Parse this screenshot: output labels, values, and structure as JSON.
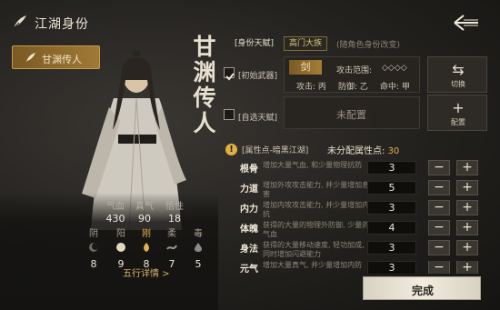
{
  "header": {
    "title": "江湖身份",
    "back_icon": "back-arrow-icon"
  },
  "sidebar": {
    "tab_label": "甘渊传人"
  },
  "character": {
    "display_name_chars": [
      "甘",
      "渊",
      "传",
      "人"
    ]
  },
  "stats": [
    {
      "label": "气血",
      "value": "430"
    },
    {
      "label": "真气",
      "value": "90"
    },
    {
      "label": "悟性",
      "value": "18"
    }
  ],
  "elements": [
    {
      "label": "阴",
      "value": "8",
      "icon": "yin-icon",
      "color": "#6d6a64"
    },
    {
      "label": "阳",
      "value": "9",
      "icon": "yang-icon",
      "color": "#e2d9c5"
    },
    {
      "label": "刚",
      "value": "8",
      "icon": "gang-icon",
      "color": "#e2b04c"
    },
    {
      "label": "柔",
      "value": "7",
      "icon": "rou-icon",
      "color": "#9c968b"
    },
    {
      "label": "毒",
      "value": "5",
      "icon": "poison-icon",
      "color": "#8a8a8a"
    }
  ],
  "details_button": "五行详情 >",
  "identity": {
    "label": "[身份天赋]",
    "sect": "高门大族",
    "note": "(随角色身份改变)"
  },
  "weapon": {
    "label": "[初始武器]",
    "type": "剑",
    "range_label": "攻击范围:",
    "range_value": "◇◇◇◇",
    "attack": "攻击: 丙",
    "defense": "防御: 乙",
    "accuracy": "命中: 甲",
    "switch_label": "切换"
  },
  "talent": {
    "label": "[自选天赋]",
    "status": "未配置",
    "config_label": "配置"
  },
  "attributes_header": {
    "title": "[属性点-暗黑江湖]",
    "unallocated_label": "未分配属性点:",
    "unallocated_value": "30"
  },
  "attributes": [
    {
      "name": "根骨",
      "desc": "增加大量气血, 和少量物理抗防",
      "value": "3"
    },
    {
      "name": "力道",
      "desc": "增加外攻攻击能力, 并少量增加息害",
      "value": "5"
    },
    {
      "name": "内力",
      "desc": "增加内攻攻击能力, 并少量增加内抗",
      "value": "3"
    },
    {
      "name": "体魄",
      "desc": "获得的大量的物理外防御, 少量的气血",
      "value": "4"
    },
    {
      "name": "身法",
      "desc": "获得的大量移动速度, 轻功加成, 同时增加闪避能力",
      "value": "3"
    },
    {
      "name": "元气",
      "desc": "增加大量真气, 并少量增加内防",
      "value": "3"
    }
  ],
  "finish_button": "完成",
  "colors": {
    "accent": "#a57d35",
    "highlight": "#e5b24b"
  }
}
